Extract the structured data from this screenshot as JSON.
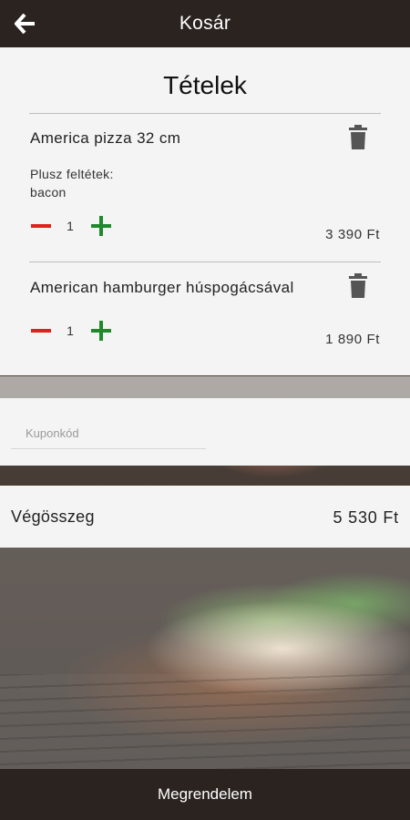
{
  "header": {
    "title": "Kosár",
    "back_icon": "arrow-left-icon"
  },
  "cart": {
    "title": "Tételek",
    "items": [
      {
        "name": "America pizza 32 cm",
        "extras_label": "Plusz feltétek:",
        "extras_value": "bacon",
        "quantity": "1",
        "price": "3 390 Ft"
      },
      {
        "name": "American hamburger húspogácsával",
        "quantity": "1",
        "price": "1 890 Ft"
      }
    ]
  },
  "coupon": {
    "placeholder": "Kuponkód",
    "value": ""
  },
  "total": {
    "label": "Végösszeg",
    "value": "5 530 Ft"
  },
  "footer": {
    "order_label": "Megrendelem"
  },
  "colors": {
    "header_bg": "#2a2320",
    "minus": "#e0201b",
    "plus": "#1e8a2c",
    "card_bg": "#f4f4f4"
  }
}
